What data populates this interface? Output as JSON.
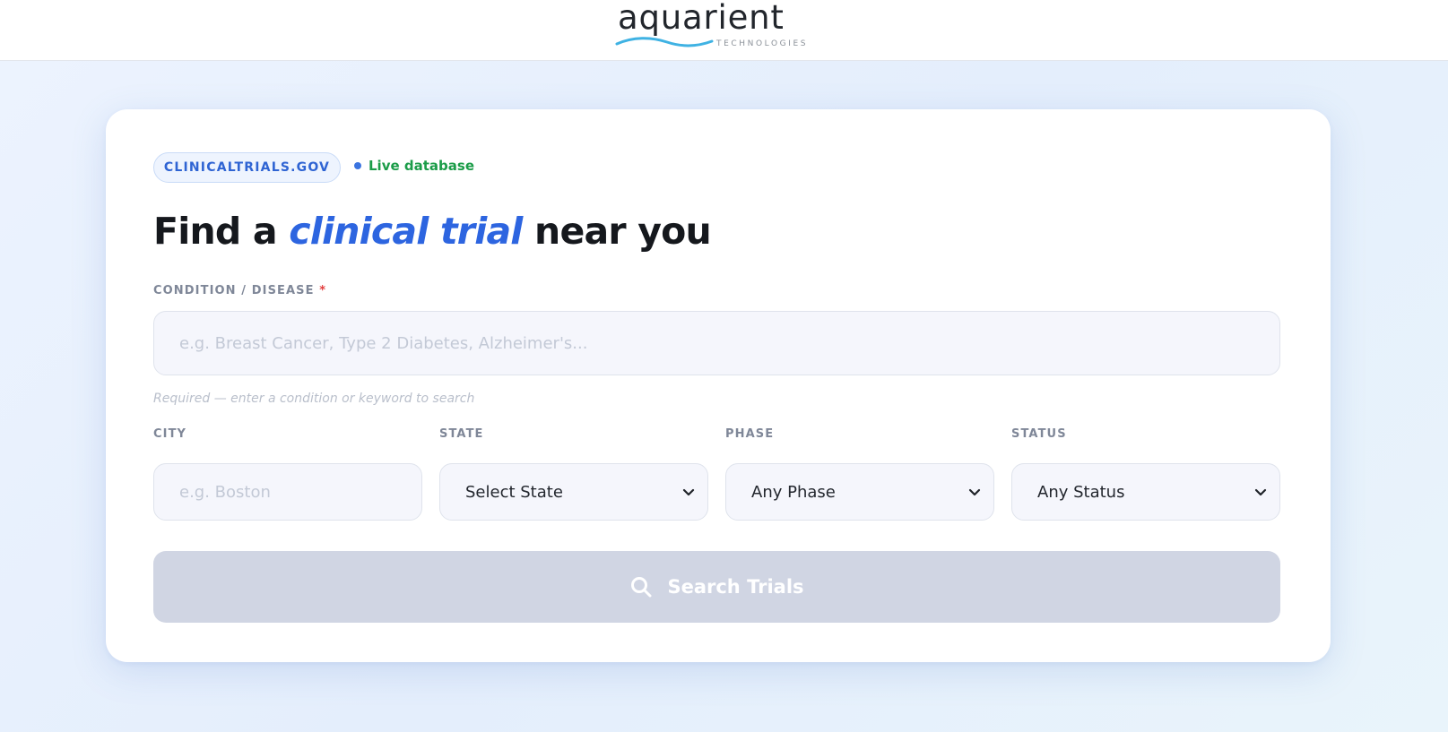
{
  "brand": {
    "name": "aquarient",
    "tagline": "TECHNOLOGIES",
    "wave_color": "#3fb2e3"
  },
  "badge": {
    "label": "CLINICALTRIALS.GOV"
  },
  "status": {
    "label": "Live database",
    "dot_color": "#3b74e0",
    "text_color": "#1b9c48"
  },
  "heading": {
    "before": "Find a ",
    "accent": "clinical trial",
    "after": " near you"
  },
  "condition": {
    "label": "CONDITION / DISEASE",
    "required_mark": "*",
    "value": "",
    "placeholder": "e.g. Breast Cancer, Type 2 Diabetes, Alzheimer's...",
    "hint": "Required — enter a condition or keyword to search"
  },
  "city": {
    "label": "CITY",
    "value": "",
    "placeholder": "e.g. Boston"
  },
  "state": {
    "label": "STATE",
    "selected": "Select State"
  },
  "phase": {
    "label": "PHASE",
    "selected": "Any Phase"
  },
  "trial_status": {
    "label": "STATUS",
    "selected": "Any Status"
  },
  "search_button": {
    "label": "Search Trials",
    "icon": "search-icon",
    "state": "disabled"
  },
  "colors": {
    "accent": "#2d65e0",
    "button_disabled": "#d0d5e3"
  }
}
